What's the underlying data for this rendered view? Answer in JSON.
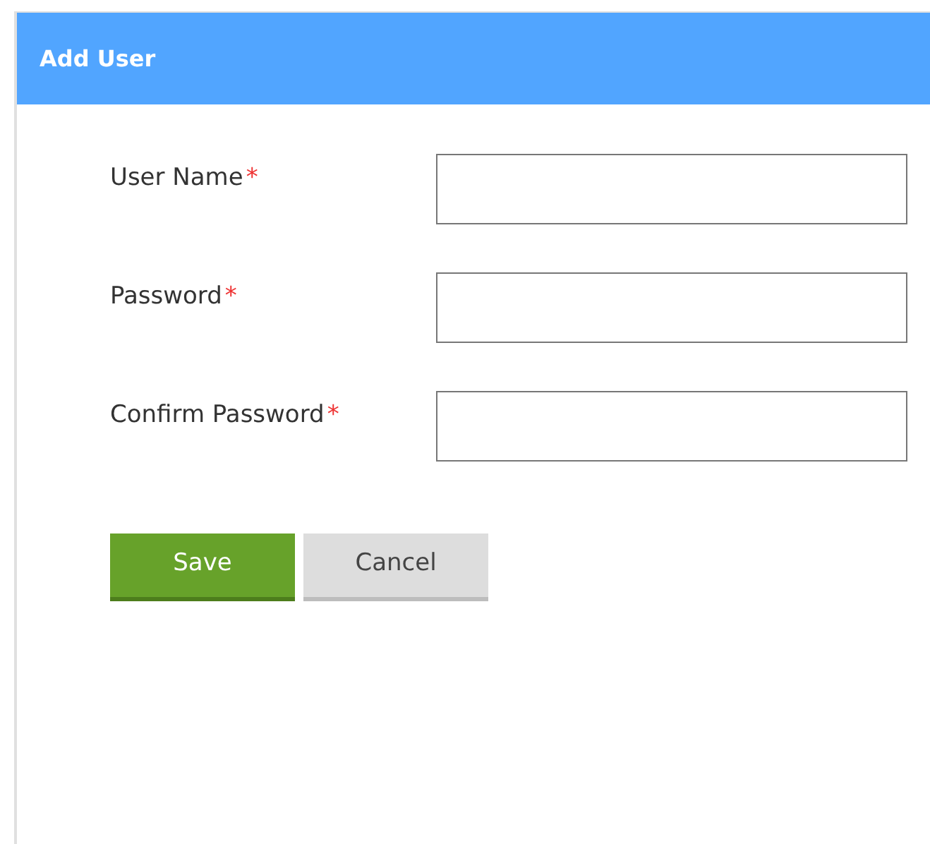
{
  "dialog": {
    "title": "Add User"
  },
  "fields": [
    {
      "label": "User Name",
      "required_mark": "*"
    },
    {
      "label": "Password",
      "required_mark": "*"
    },
    {
      "label": "Confirm Password",
      "required_mark": "*"
    }
  ],
  "buttons": [
    {
      "label": "Save",
      "kind": "primary"
    },
    {
      "label": "Cancel",
      "kind": "secondary"
    }
  ]
}
